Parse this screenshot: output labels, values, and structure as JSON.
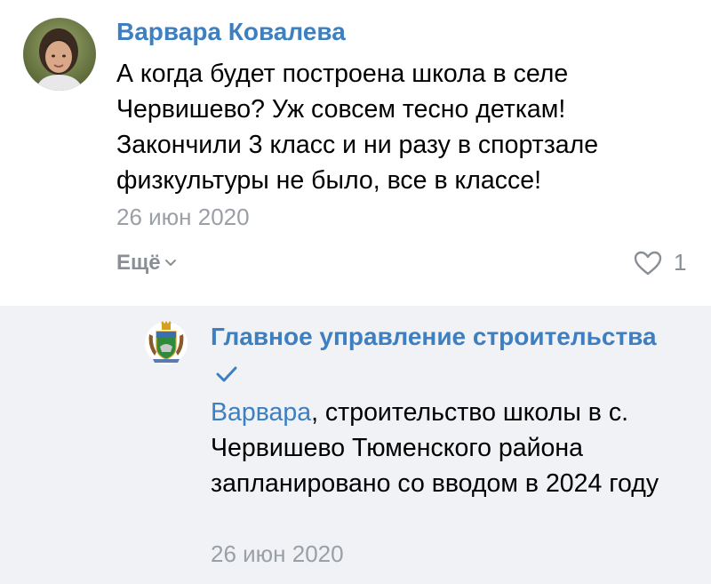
{
  "comment": {
    "author": "Варвара Ковалева",
    "text": "А когда будет построена школа в селе Червишево? Уж совсем тесно деткам! Закончили 3 класс и ни разу в спортзале физкультуры не было, все в классе!",
    "date": "26 июн 2020",
    "more_label": "Ещё",
    "likes": "1"
  },
  "reply": {
    "author": "Главное управление строительства",
    "mention": "Варвара",
    "text": ", строительство школы в с. Червишево Тюменского района запланировано со вводом в 2024 году",
    "date": "26 июн 2020"
  },
  "colors": {
    "link": "#3d7fc1",
    "muted": "#9aa0a6",
    "reply_background": "#f0f2f5"
  },
  "icons": {
    "more": "chevron-down-icon",
    "like": "heart-outline-icon",
    "verified": "checkmark-icon",
    "reply_avatar": "coat-of-arms-icon"
  }
}
